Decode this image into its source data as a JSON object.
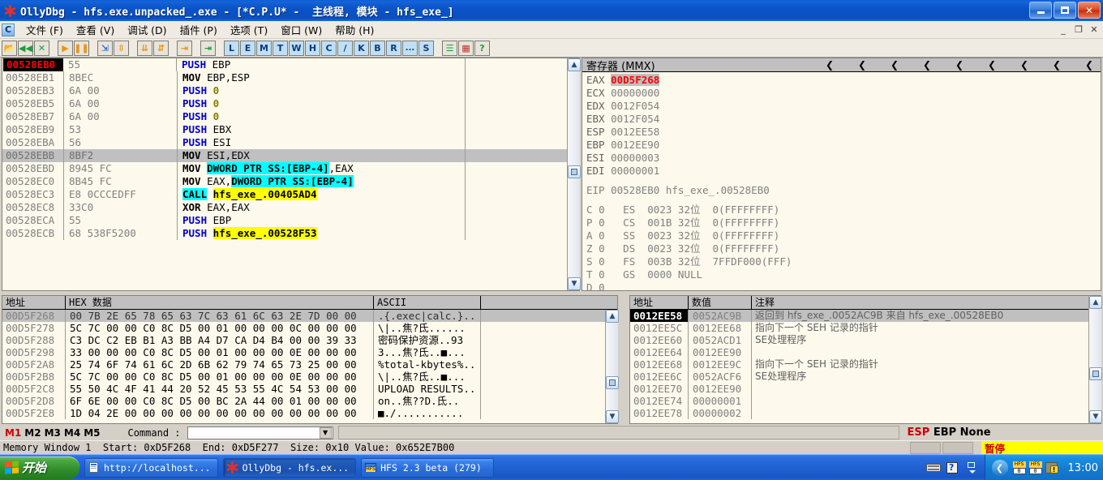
{
  "window": {
    "title": "OllyDbg - hfs.exe.unpacked_.exe - [*C.P.U* -  主线程, 模块 - hfs_exe_]",
    "minimize": "_",
    "maximize": "❐",
    "close": "✕",
    "mdi_minimize": "_",
    "mdi_restore": "❐",
    "mdi_close": "✕"
  },
  "menu": {
    "sysicon": "C",
    "items": [
      {
        "label": "文件 (F)"
      },
      {
        "label": "查看 (V)"
      },
      {
        "label": "调试 (D)"
      },
      {
        "label": "插件 (P)"
      },
      {
        "label": "选项 (T)"
      },
      {
        "label": "窗口 (W)"
      },
      {
        "label": "帮助 (H)"
      }
    ]
  },
  "toolbar": {
    "buttons": [
      {
        "name": "open-file",
        "glyph": "📂",
        "kind": "icon",
        "color": "#d8a020"
      },
      {
        "name": "restart",
        "glyph": "◀◀",
        "kind": "icon",
        "color": "#1b9e3a"
      },
      {
        "name": "close-program",
        "glyph": "✕",
        "kind": "icon",
        "color": "#1b9e3a"
      },
      {
        "name": "sep"
      },
      {
        "name": "run",
        "glyph": "▶",
        "kind": "icon",
        "color": "#e8941a"
      },
      {
        "name": "pause",
        "glyph": "❚❚",
        "kind": "icon",
        "color": "#e8941a"
      },
      {
        "name": "sep"
      },
      {
        "name": "step-into",
        "glyph": "⇲",
        "kind": "icon",
        "color": "#2a6ad8"
      },
      {
        "name": "step-over",
        "glyph": "⇳",
        "kind": "icon",
        "color": "#e8941a"
      },
      {
        "name": "sep"
      },
      {
        "name": "trace-into",
        "glyph": "⇊",
        "kind": "icon",
        "color": "#e8941a"
      },
      {
        "name": "trace-over",
        "glyph": "⇵",
        "kind": "icon",
        "color": "#e8941a"
      },
      {
        "name": "sep"
      },
      {
        "name": "execute-till-return",
        "glyph": "⇥",
        "kind": "icon",
        "color": "#e8941a"
      },
      {
        "name": "sep"
      },
      {
        "name": "run-to-selection",
        "glyph": "⇥",
        "kind": "icon",
        "color": "#1b9e3a"
      },
      {
        "name": "sep"
      },
      {
        "name": "log-window",
        "glyph": "L",
        "kind": "letter"
      },
      {
        "name": "executable-modules",
        "glyph": "E",
        "kind": "letter"
      },
      {
        "name": "memory-map",
        "glyph": "M",
        "kind": "letter"
      },
      {
        "name": "threads",
        "glyph": "T",
        "kind": "letter"
      },
      {
        "name": "windows",
        "glyph": "W",
        "kind": "letter"
      },
      {
        "name": "handles",
        "glyph": "H",
        "kind": "letter"
      },
      {
        "name": "cpu-window",
        "glyph": "C",
        "kind": "letter"
      },
      {
        "name": "patches",
        "glyph": "/",
        "kind": "letter"
      },
      {
        "name": "call-stack",
        "glyph": "K",
        "kind": "letter"
      },
      {
        "name": "breakpoints",
        "glyph": "B",
        "kind": "letter"
      },
      {
        "name": "references",
        "glyph": "R",
        "kind": "letter"
      },
      {
        "name": "run-trace",
        "glyph": "...",
        "kind": "letter"
      },
      {
        "name": "source",
        "glyph": "S",
        "kind": "letter"
      },
      {
        "name": "sep"
      },
      {
        "name": "options-list",
        "glyph": "☰",
        "kind": "icon",
        "color": "#1b9e3a"
      },
      {
        "name": "appearance",
        "glyph": "▦",
        "kind": "icon",
        "color": "#c03030"
      },
      {
        "name": "help",
        "glyph": "?",
        "kind": "icon",
        "color": "#1b9e3a"
      }
    ]
  },
  "disassembly": {
    "rows": [
      {
        "addr": "00528EB0",
        "hex": "55",
        "eip": true,
        "selected": false,
        "parts": [
          {
            "t": "PUSH ",
            "c": "mn"
          },
          {
            "t": "EBP",
            "c": ""
          }
        ]
      },
      {
        "addr": "00528EB1",
        "hex": "8BEC",
        "eip": false,
        "selected": false,
        "parts": [
          {
            "t": "MOV ",
            "c": "mn-blk"
          },
          {
            "t": "EBP,ESP",
            "c": ""
          }
        ]
      },
      {
        "addr": "00528EB3",
        "hex": "6A 00",
        "eip": false,
        "selected": false,
        "parts": [
          {
            "t": "PUSH ",
            "c": "mn"
          },
          {
            "t": "0",
            "c": "num"
          }
        ]
      },
      {
        "addr": "00528EB5",
        "hex": "6A 00",
        "eip": false,
        "selected": false,
        "parts": [
          {
            "t": "PUSH ",
            "c": "mn"
          },
          {
            "t": "0",
            "c": "num"
          }
        ]
      },
      {
        "addr": "00528EB7",
        "hex": "6A 00",
        "eip": false,
        "selected": false,
        "parts": [
          {
            "t": "PUSH ",
            "c": "mn"
          },
          {
            "t": "0",
            "c": "num"
          }
        ]
      },
      {
        "addr": "00528EB9",
        "hex": "53",
        "eip": false,
        "selected": false,
        "parts": [
          {
            "t": "PUSH ",
            "c": "mn"
          },
          {
            "t": "EBX",
            "c": ""
          }
        ]
      },
      {
        "addr": "00528EBA",
        "hex": "56",
        "eip": false,
        "selected": false,
        "parts": [
          {
            "t": "PUSH ",
            "c": "mn"
          },
          {
            "t": "ESI",
            "c": ""
          }
        ]
      },
      {
        "addr": "00528EBB",
        "hex": "8BF2",
        "eip": false,
        "selected": true,
        "parts": [
          {
            "t": "MOV ",
            "c": "mn-blk"
          },
          {
            "t": "ESI,EDX",
            "c": ""
          }
        ]
      },
      {
        "addr": "00528EBD",
        "hex": "8945 FC",
        "eip": false,
        "selected": false,
        "parts": [
          {
            "t": "MOV ",
            "c": "mn-blk"
          },
          {
            "t": "DWORD PTR SS:[EBP-4]",
            "c": "hl-cyan"
          },
          {
            "t": ",EAX",
            "c": ""
          }
        ]
      },
      {
        "addr": "00528EC0",
        "hex": "8B45 FC",
        "eip": false,
        "selected": false,
        "parts": [
          {
            "t": "MOV ",
            "c": "mn-blk"
          },
          {
            "t": "EAX,",
            "c": ""
          },
          {
            "t": "DWORD PTR SS:[EBP-4]",
            "c": "hl-cyan"
          }
        ]
      },
      {
        "addr": "00528EC3",
        "hex": "E8 0CCCEDFF",
        "eip": false,
        "selected": false,
        "parts": [
          {
            "t": "CALL",
            "c": "hl-cyan"
          },
          {
            "t": " ",
            "c": ""
          },
          {
            "t": "hfs_exe_.00405AD4",
            "c": "hl-yellow"
          }
        ]
      },
      {
        "addr": "00528EC8",
        "hex": "33C0",
        "eip": false,
        "selected": false,
        "parts": [
          {
            "t": "XOR ",
            "c": "mn-blk"
          },
          {
            "t": "EAX,EAX",
            "c": ""
          }
        ]
      },
      {
        "addr": "00528ECA",
        "hex": "55",
        "eip": false,
        "selected": false,
        "parts": [
          {
            "t": "PUSH ",
            "c": "mn"
          },
          {
            "t": "EBP",
            "c": ""
          }
        ]
      },
      {
        "addr": "00528ECB",
        "hex": "68 538F5200",
        "eip": false,
        "selected": false,
        "parts": [
          {
            "t": "PUSH ",
            "c": "mn"
          },
          {
            "t": "hfs_exe_.00528F53",
            "c": "hl-yellow"
          }
        ]
      }
    ]
  },
  "registers": {
    "title": "寄存器 (MMX)",
    "chevron": "❮",
    "chevron_count": 9,
    "gp": [
      {
        "name": "EAX",
        "value": "00D5F268",
        "highlight": true
      },
      {
        "name": "ECX",
        "value": "00000000",
        "highlight": false
      },
      {
        "name": "EDX",
        "value": "0012F054",
        "highlight": false
      },
      {
        "name": "EBX",
        "value": "0012F054",
        "highlight": false
      },
      {
        "name": "ESP",
        "value": "0012EE58",
        "highlight": false
      },
      {
        "name": "EBP",
        "value": "0012EE90",
        "highlight": false
      },
      {
        "name": "ESI",
        "value": "00000003",
        "highlight": false
      },
      {
        "name": "EDI",
        "value": "00000001",
        "highlight": false
      }
    ],
    "eip": {
      "name": "EIP",
      "value": "00528EB0",
      "symbol": "hfs_exe_.00528EB0"
    },
    "flags": [
      {
        "flag": "C",
        "bit": "0",
        "seg": "ES",
        "sel": "0023",
        "mode": "32位",
        "base": "0(FFFFFFFF)"
      },
      {
        "flag": "P",
        "bit": "0",
        "seg": "CS",
        "sel": "001B",
        "mode": "32位",
        "base": "0(FFFFFFFF)"
      },
      {
        "flag": "A",
        "bit": "0",
        "seg": "SS",
        "sel": "0023",
        "mode": "32位",
        "base": "0(FFFFFFFF)"
      },
      {
        "flag": "Z",
        "bit": "0",
        "seg": "DS",
        "sel": "0023",
        "mode": "32位",
        "base": "0(FFFFFFFF)"
      },
      {
        "flag": "S",
        "bit": "0",
        "seg": "FS",
        "sel": "003B",
        "mode": "32位",
        "base": "7FFDF000(FFF)"
      },
      {
        "flag": "T",
        "bit": "0",
        "seg": "GS",
        "sel": "0000",
        "mode": "NULL",
        "base": ""
      },
      {
        "flag": "D",
        "bit": "0",
        "seg": "",
        "sel": "",
        "mode": "",
        "base": ""
      }
    ]
  },
  "dump": {
    "headers": [
      "地址",
      "HEX 数据",
      "ASCII",
      ""
    ],
    "rows": [
      {
        "addr": "00D5F268",
        "hex": "00 7B 2E 65 78 65 63 7C 63 61 6C 63 2E 7D 00 00",
        "ascii": ".{.exec|calc.}..",
        "selected": true
      },
      {
        "addr": "00D5F278",
        "hex": "5C 7C 00 00 C0 8C D5 00 01 00 00 00 0C 00 00 00",
        "ascii": "\\|..焦?氐......",
        "selected": false
      },
      {
        "addr": "00D5F288",
        "hex": "C3 DC C2 EB B1 A3 BB A4 D7 CA D4 B4 00 00 39 33",
        "ascii": "密码保护资源..93",
        "selected": false
      },
      {
        "addr": "00D5F298",
        "hex": "33 00 00 00 C0 8C D5 00 01 00 00 00 0E 00 00 00",
        "ascii": "3...焦?氐..■...",
        "selected": false
      },
      {
        "addr": "00D5F2A8",
        "hex": "25 74 6F 74 61 6C 2D 6B 62 79 74 65 73 25 00 00",
        "ascii": "%total-kbytes%..",
        "selected": false
      },
      {
        "addr": "00D5F2B8",
        "hex": "5C 7C 00 00 C0 8C D5 00 01 00 00 00 0E 00 00 00",
        "ascii": "\\|..焦?氐..■...",
        "selected": false
      },
      {
        "addr": "00D5F2C8",
        "hex": "55 50 4C 4F 41 44 20 52 45 53 55 4C 54 53 00 00",
        "ascii": "UPLOAD RESULTS..",
        "selected": false
      },
      {
        "addr": "00D5F2D8",
        "hex": "6F 6E 00 00 C0 8C D5 00 BC 2A 44 00 01 00 00 00",
        "ascii": "on..焦??D.氐..",
        "selected": false
      },
      {
        "addr": "00D5F2E8",
        "hex": "1D 04 2E 00 00 00 00 00 00 00 00 00 00 00 00 00",
        "ascii": "■.∕...........",
        "selected": false
      }
    ]
  },
  "stack": {
    "headers": [
      "地址",
      "数值",
      "注释"
    ],
    "rows": [
      {
        "addr": "0012EE58",
        "value": "0052AC9B",
        "comment": "返回到 hfs_exe_.0052AC9B 来自 hfs_exe_.00528EB0",
        "selected": true
      },
      {
        "addr": "0012EE5C",
        "value": "0012EE68",
        "comment": "指向下一个 SEH 记录的指针",
        "selected": false
      },
      {
        "addr": "0012EE60",
        "value": "0052ACD1",
        "comment": "SE处理程序",
        "selected": false
      },
      {
        "addr": "0012EE64",
        "value": "0012EE90",
        "comment": "",
        "selected": false
      },
      {
        "addr": "0012EE68",
        "value": "0012EE9C",
        "comment": "指向下一个 SEH 记录的指针",
        "selected": false
      },
      {
        "addr": "0012EE6C",
        "value": "0052ACF6",
        "comment": "SE处理程序",
        "selected": false
      },
      {
        "addr": "0012EE70",
        "value": "0012EE90",
        "comment": "",
        "selected": false
      },
      {
        "addr": "0012EE74",
        "value": "00000001",
        "comment": "",
        "selected": false
      },
      {
        "addr": "0012EE78",
        "value": "00000002",
        "comment": "",
        "selected": false
      }
    ]
  },
  "commandbar": {
    "memtags": [
      "M1",
      "M2",
      "M3",
      "M4",
      "M5"
    ],
    "label": "Command :",
    "value": "",
    "placeholder": "",
    "dropdown_glyph": "▼",
    "esp_ebp": "ESP EBP None"
  },
  "statusbar": {
    "text": "Memory Window 1  Start: 0xD5F268  End: 0xD5F277  Size: 0x10 Value: 0x652E7B00",
    "state": "暂停"
  },
  "taskbar": {
    "start_label": "开始",
    "items": [
      {
        "label": "http://localhost...",
        "icon": "browser-icon",
        "active": false
      },
      {
        "label": "OllyDbg - hfs.ex...",
        "icon": "ollydbg-icon",
        "active": true
      },
      {
        "label": "HFS 2.3 beta (279)",
        "icon": "hfs-icon",
        "active": false
      }
    ],
    "tray": {
      "show_desktop": "❮",
      "icons": [
        "hfs-tray-icon-1",
        "hfs-tray-icon-2",
        "warning-shield-icon"
      ],
      "time": "13:00"
    },
    "quicklaunch": [
      "keyboard-icon",
      "help-icon",
      "cascade-icon"
    ]
  }
}
